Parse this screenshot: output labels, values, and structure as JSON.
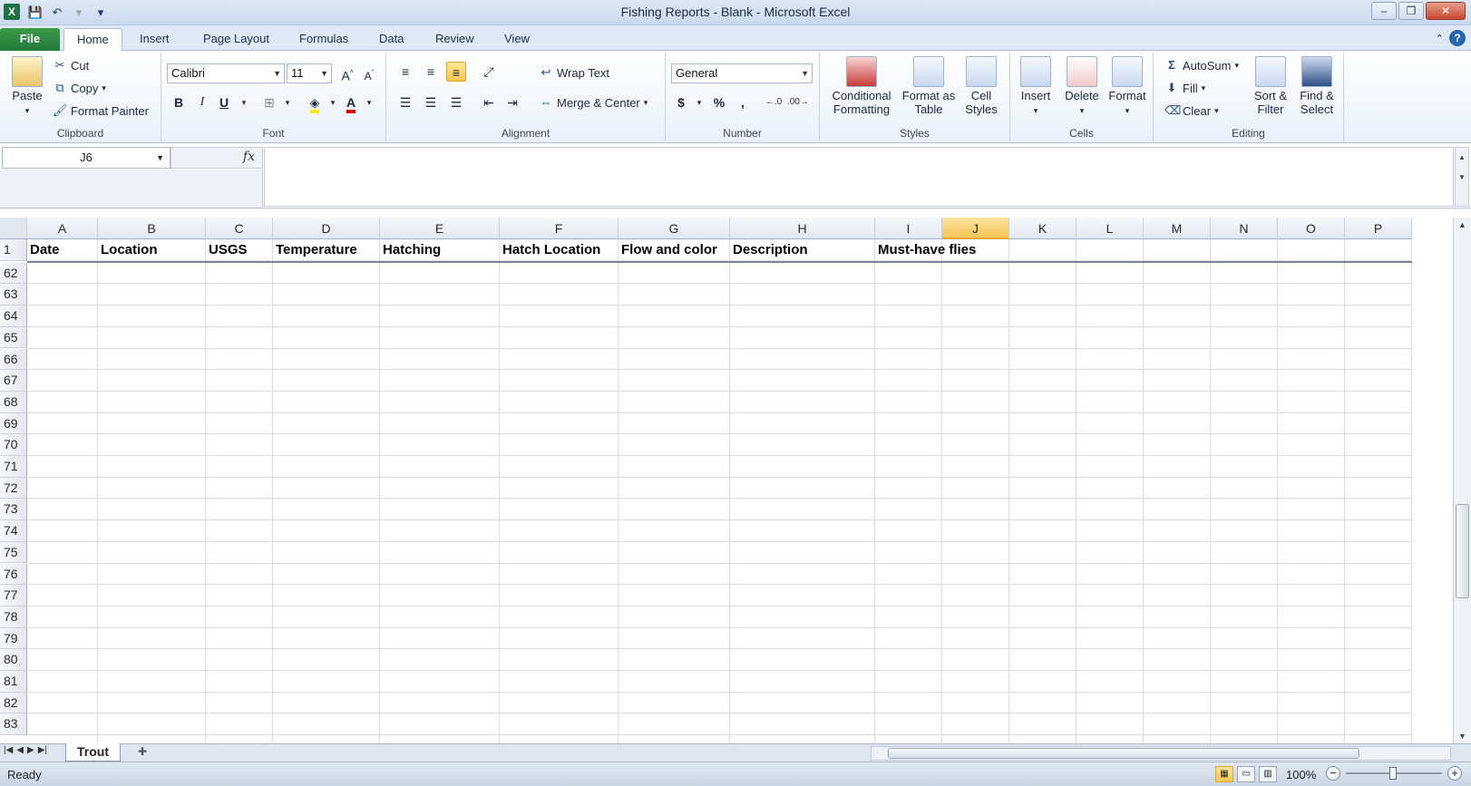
{
  "window": {
    "title": "Fishing Reports - Blank  -  Microsoft Excel",
    "app_badge": "X"
  },
  "tabs": [
    {
      "label": "File"
    },
    {
      "label": "Home"
    },
    {
      "label": "Insert"
    },
    {
      "label": "Page Layout"
    },
    {
      "label": "Formulas"
    },
    {
      "label": "Data"
    },
    {
      "label": "Review"
    },
    {
      "label": "View"
    }
  ],
  "ribbon": {
    "clipboard": {
      "paste": "Paste",
      "cut": "Cut",
      "copy": "Copy",
      "format_painter": "Format Painter",
      "label": "Clipboard"
    },
    "font": {
      "name": "Calibri",
      "size": "11",
      "bold": "B",
      "italic": "I",
      "underline": "U",
      "label": "Font"
    },
    "alignment": {
      "wrap": "Wrap Text",
      "merge": "Merge & Center",
      "label": "Alignment"
    },
    "number": {
      "format": "General",
      "currency": "$",
      "percent": "%",
      "comma": ",",
      "label": "Number"
    },
    "styles": {
      "conditional": "Conditional Formatting",
      "as_table": "Format as Table",
      "cell_styles": "Cell Styles",
      "label": "Styles"
    },
    "cells": {
      "insert": "Insert",
      "delete": "Delete",
      "format": "Format",
      "label": "Cells"
    },
    "editing": {
      "autosum": "AutoSum",
      "fill": "Fill",
      "clear": "Clear",
      "sort": "Sort & Filter",
      "find": "Find & Select",
      "label": "Editing"
    }
  },
  "formula_bar": {
    "name_box": "J6",
    "fx": "fx",
    "value": ""
  },
  "sheet": {
    "columns": [
      "A",
      "B",
      "C",
      "D",
      "E",
      "F",
      "G",
      "H",
      "I",
      "J",
      "K",
      "L",
      "M",
      "N",
      "O",
      "P"
    ],
    "selected_column": "J",
    "header_row_number": "1",
    "headers": [
      "Date",
      "Location",
      "USGS",
      "Temperature",
      "Hatching",
      "Hatch Location",
      "Flow and color",
      "Description",
      "Must-have flies"
    ],
    "rows": [
      "62",
      "63",
      "64",
      "65",
      "66",
      "67",
      "68",
      "69",
      "70",
      "71",
      "72",
      "73",
      "74",
      "75",
      "76",
      "77",
      "78",
      "79",
      "80",
      "81",
      "82",
      "83"
    ]
  },
  "sheet_tabs": [
    {
      "label": "Trout",
      "active": true
    }
  ],
  "status": {
    "ready": "Ready",
    "zoom": "100%"
  }
}
